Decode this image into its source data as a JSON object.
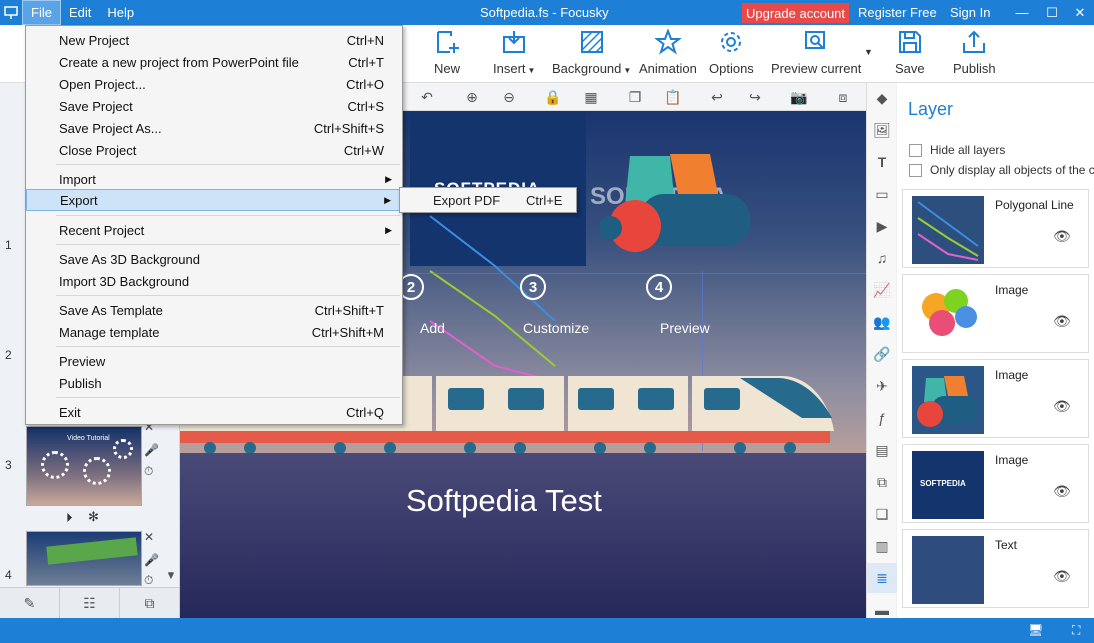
{
  "titlebar": {
    "menus": [
      "File",
      "Edit",
      "Help"
    ],
    "title": "Softpedia.fs - Focusky",
    "upgrade": "Upgrade account",
    "register": "Register Free",
    "signin": "Sign In"
  },
  "toolbar": {
    "new": "New",
    "insert": "Insert",
    "background": "Background",
    "animation": "Animation",
    "options": "Options",
    "preview_current": "Preview current",
    "save": "Save",
    "publish": "Publish"
  },
  "file_menu": {
    "items": [
      {
        "label": "New Project",
        "shortcut": "Ctrl+N"
      },
      {
        "label": "Create a new project from PowerPoint file",
        "shortcut": "Ctrl+T"
      },
      {
        "label": "Open Project...",
        "shortcut": "Ctrl+O"
      },
      {
        "label": "Save Project",
        "shortcut": "Ctrl+S"
      },
      {
        "label": "Save Project As...",
        "shortcut": "Ctrl+Shift+S"
      },
      {
        "label": "Close Project",
        "shortcut": "Ctrl+W"
      },
      {
        "label": "Import",
        "shortcut": ""
      },
      {
        "label": "Export",
        "shortcut": ""
      },
      {
        "label": "Recent Project",
        "shortcut": ""
      },
      {
        "label": "Save As 3D Background",
        "shortcut": ""
      },
      {
        "label": "Import 3D Background",
        "shortcut": ""
      },
      {
        "label": "Save As Template",
        "shortcut": "Ctrl+Shift+T"
      },
      {
        "label": "Manage template",
        "shortcut": "Ctrl+Shift+M"
      },
      {
        "label": "Preview",
        "shortcut": ""
      },
      {
        "label": "Publish",
        "shortcut": ""
      },
      {
        "label": "Exit",
        "shortcut": "Ctrl+Q"
      }
    ],
    "export_submenu": {
      "label": "Export PDF",
      "shortcut": "Ctrl+E"
    }
  },
  "slides": {
    "numbers": [
      "1",
      "2",
      "3",
      "4"
    ],
    "thumb3_title": "Video Tutorial"
  },
  "canvas": {
    "logo": "SOFTPEDIA",
    "watermark": "SOFTPEDIA",
    "steps": [
      {
        "num": "2",
        "label": "Add"
      },
      {
        "num": "3",
        "label": "Customize"
      },
      {
        "num": "4",
        "label": "Preview"
      }
    ],
    "title": "Softpedia Test"
  },
  "layer_panel": {
    "title": "Layer",
    "hide_all": "Hide all layers",
    "only_display": "Only display all objects of the c",
    "items": [
      {
        "name": "Polygonal Line"
      },
      {
        "name": "Image"
      },
      {
        "name": "Image"
      },
      {
        "name": "Image"
      },
      {
        "name": "Text"
      }
    ],
    "image3_logo": "SOFTPEDIA"
  }
}
